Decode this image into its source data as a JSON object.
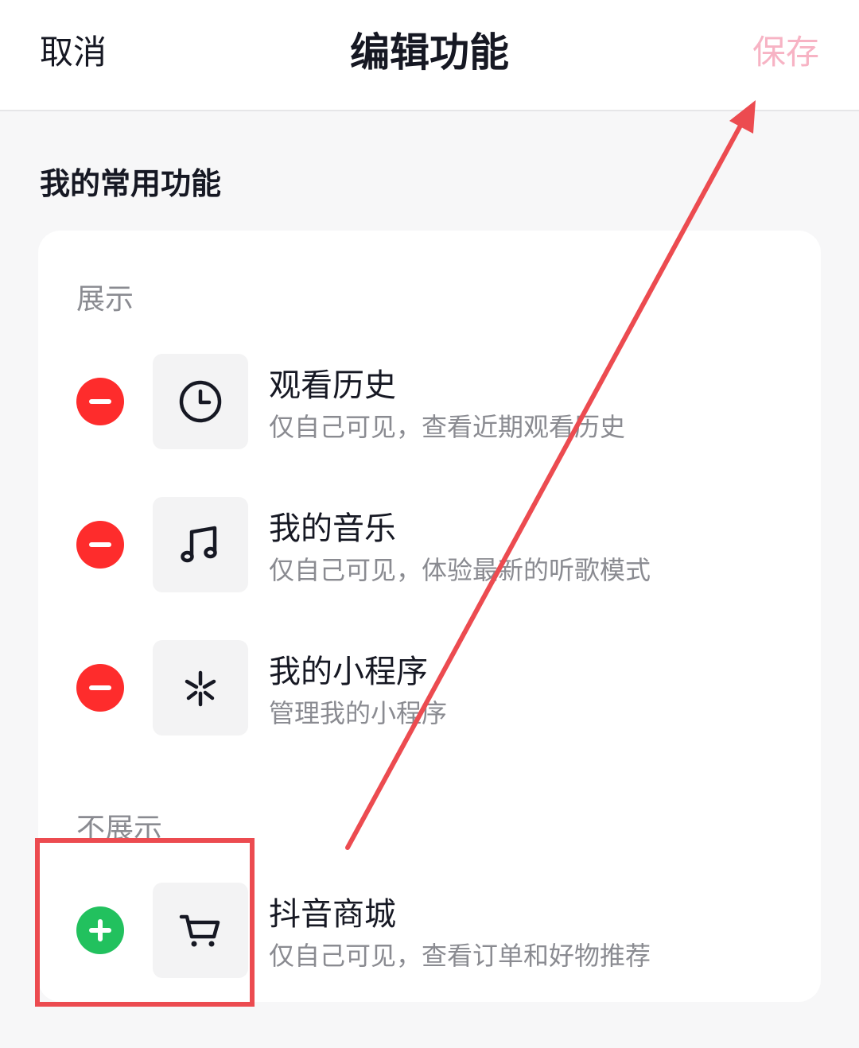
{
  "header": {
    "cancel_label": "取消",
    "title": "编辑功能",
    "save_label": "保存"
  },
  "section_title": "我的常用功能",
  "groups": {
    "shown_label": "展示",
    "hidden_label": "不展示"
  },
  "items": [
    {
      "title": "观看历史",
      "desc": "仅自己可见，查看近期观看历史",
      "icon": "clock-icon",
      "action": "remove"
    },
    {
      "title": "我的音乐",
      "desc": "仅自己可见，体验最新的听歌模式",
      "icon": "music-note-icon",
      "action": "remove"
    },
    {
      "title": "我的小程序",
      "desc": "管理我的小程序",
      "icon": "mini-program-icon",
      "action": "remove"
    },
    {
      "title": "抖音商城",
      "desc": "仅自己可见，查看订单和好物推荐",
      "icon": "shopping-cart-icon",
      "action": "add"
    }
  ],
  "colors": {
    "remove": "#fe2c2c",
    "add": "#22c15e",
    "save_disabled": "#f7b3c4",
    "annotation": "#ec4b50"
  }
}
